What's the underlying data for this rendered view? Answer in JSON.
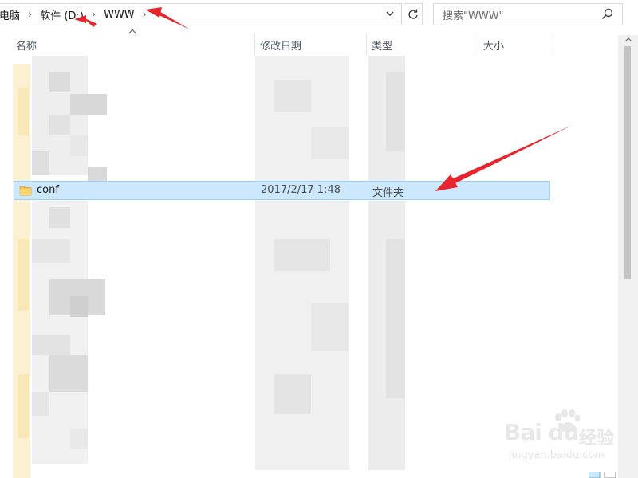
{
  "address_bar": {
    "crumbs": [
      "电脑",
      "软件 (D:)",
      "WWW"
    ],
    "separator": "›"
  },
  "search": {
    "placeholder": "搜索\"WWW\""
  },
  "columns": {
    "name": "名称",
    "date": "修改日期",
    "type": "类型",
    "size": "大小"
  },
  "selected_item": {
    "name": "conf",
    "date": "2017/2/17 1:48",
    "type": "文件夹",
    "icon": "folder-icon"
  },
  "colors": {
    "selection_bg": "#cce8ff",
    "selection_border": "#99d1ff",
    "folder": "#f3c24f",
    "annotation_arrow": "#e8242d"
  },
  "watermark": {
    "brand": "Bai du",
    "cn": "经验",
    "url": "jingyan.baidu.com"
  }
}
